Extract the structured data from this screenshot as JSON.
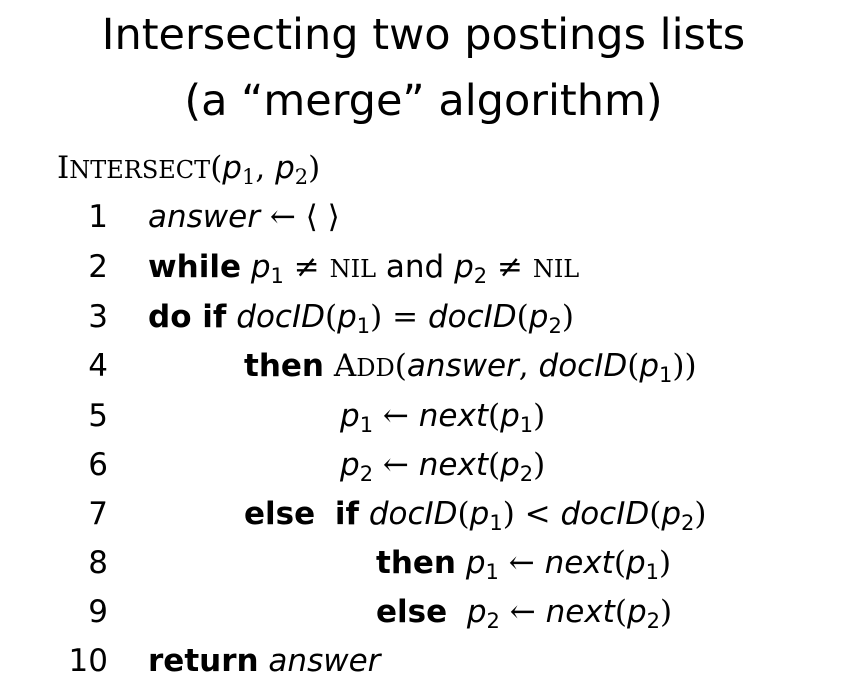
{
  "title": {
    "line1": "Intersecting two postings lists",
    "line2": "(a “merge” algorithm)"
  },
  "header": {
    "fn_first": "I",
    "fn_rest": "NTERSECT",
    "open": "(",
    "p": "p",
    "one": "1",
    "comma": ", ",
    "two": "2",
    "close": ")"
  },
  "lines": [
    {
      "num": "1"
    },
    {
      "num": "2"
    },
    {
      "num": "3"
    },
    {
      "num": "4"
    },
    {
      "num": "5"
    },
    {
      "num": "6"
    },
    {
      "num": "7"
    },
    {
      "num": "8"
    },
    {
      "num": "9"
    },
    {
      "num": "10"
    }
  ],
  "tokens": {
    "answer": "answer",
    "larrow": " ← ",
    "empty_list": "⟨ ⟩",
    "while": "while",
    "p": "p",
    "one": "1",
    "two": "2",
    "neq": " ≠ ",
    "nil": "NIL",
    "and": " and ",
    "do_if": "do if",
    "docid": "docID",
    "lparen": "(",
    "rparen": ")",
    "eq": " = ",
    "lt": " < ",
    "then": "then",
    "add_first": "A",
    "add_rest": "DD",
    "comma": ", ",
    "next": "next",
    "else": "else",
    "if": "if",
    "return": "return"
  }
}
